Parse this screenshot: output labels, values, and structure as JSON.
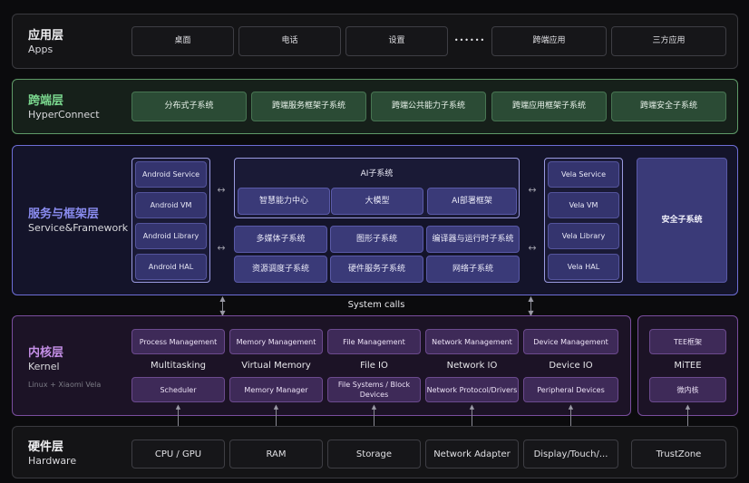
{
  "apps": {
    "title": "应用层",
    "subtitle": "Apps",
    "items": [
      "桌面",
      "电话",
      "设置",
      "三方应用"
    ],
    "portal": "跨端应用",
    "ellipsis": "••••••"
  },
  "hyperconnect": {
    "title": "跨端层",
    "subtitle": "HyperConnect",
    "items": [
      "分布式子系统",
      "跨端服务框架子系统",
      "跨端公共能力子系统",
      "跨端应用框架子系统",
      "跨端安全子系统"
    ]
  },
  "service": {
    "title": "服务与框架层",
    "subtitle": "Service&Framework",
    "android": [
      "Android Service",
      "Android VM",
      "Android Library",
      "Android HAL"
    ],
    "ai": {
      "title": "AI子系统",
      "items": [
        "智慧能力中心",
        "大模型",
        "AI部署框架"
      ]
    },
    "subsystems": [
      "多媒体子系统",
      "图形子系统",
      "编译器与运行时子系统",
      "资源调度子系统",
      "硬件服务子系统",
      "网络子系统"
    ],
    "vela": [
      "Vela Service",
      "Vela VM",
      "Vela Library",
      "Vela HAL"
    ],
    "security": "安全子系统",
    "arrow": "↔"
  },
  "system_calls": "System calls",
  "kernel": {
    "title": "内核层",
    "subtitle": "Kernel",
    "note": "Linux + Xiaomi Vela",
    "columns": [
      {
        "top": "Process Management",
        "middle": "Multitasking",
        "bottom": "Scheduler"
      },
      {
        "top": "Memory Management",
        "middle": "Virtual Memory",
        "bottom": "Memory Manager"
      },
      {
        "top": "File Management",
        "middle": "File IO",
        "bottom": "File Systems / Block Devices"
      },
      {
        "top": "Network Management",
        "middle": "Network IO",
        "bottom": "Network Protocol/Drivers"
      },
      {
        "top": "Device Management",
        "middle": "Device IO",
        "bottom": "Peripheral Devices"
      }
    ],
    "mitee": {
      "top": "TEE框架",
      "middle": "MiTEE",
      "bottom": "微内核"
    }
  },
  "hardware": {
    "title": "硬件层",
    "subtitle": "Hardware",
    "items": [
      "CPU / GPU",
      "RAM",
      "Storage",
      "Network Adapter",
      "Display/Touch/...",
      "TrustZone"
    ]
  },
  "colors": {
    "hyperconnect_accent": "#7bd88f",
    "service_accent": "#8a8cf0",
    "kernel_accent": "#c48fe6"
  }
}
